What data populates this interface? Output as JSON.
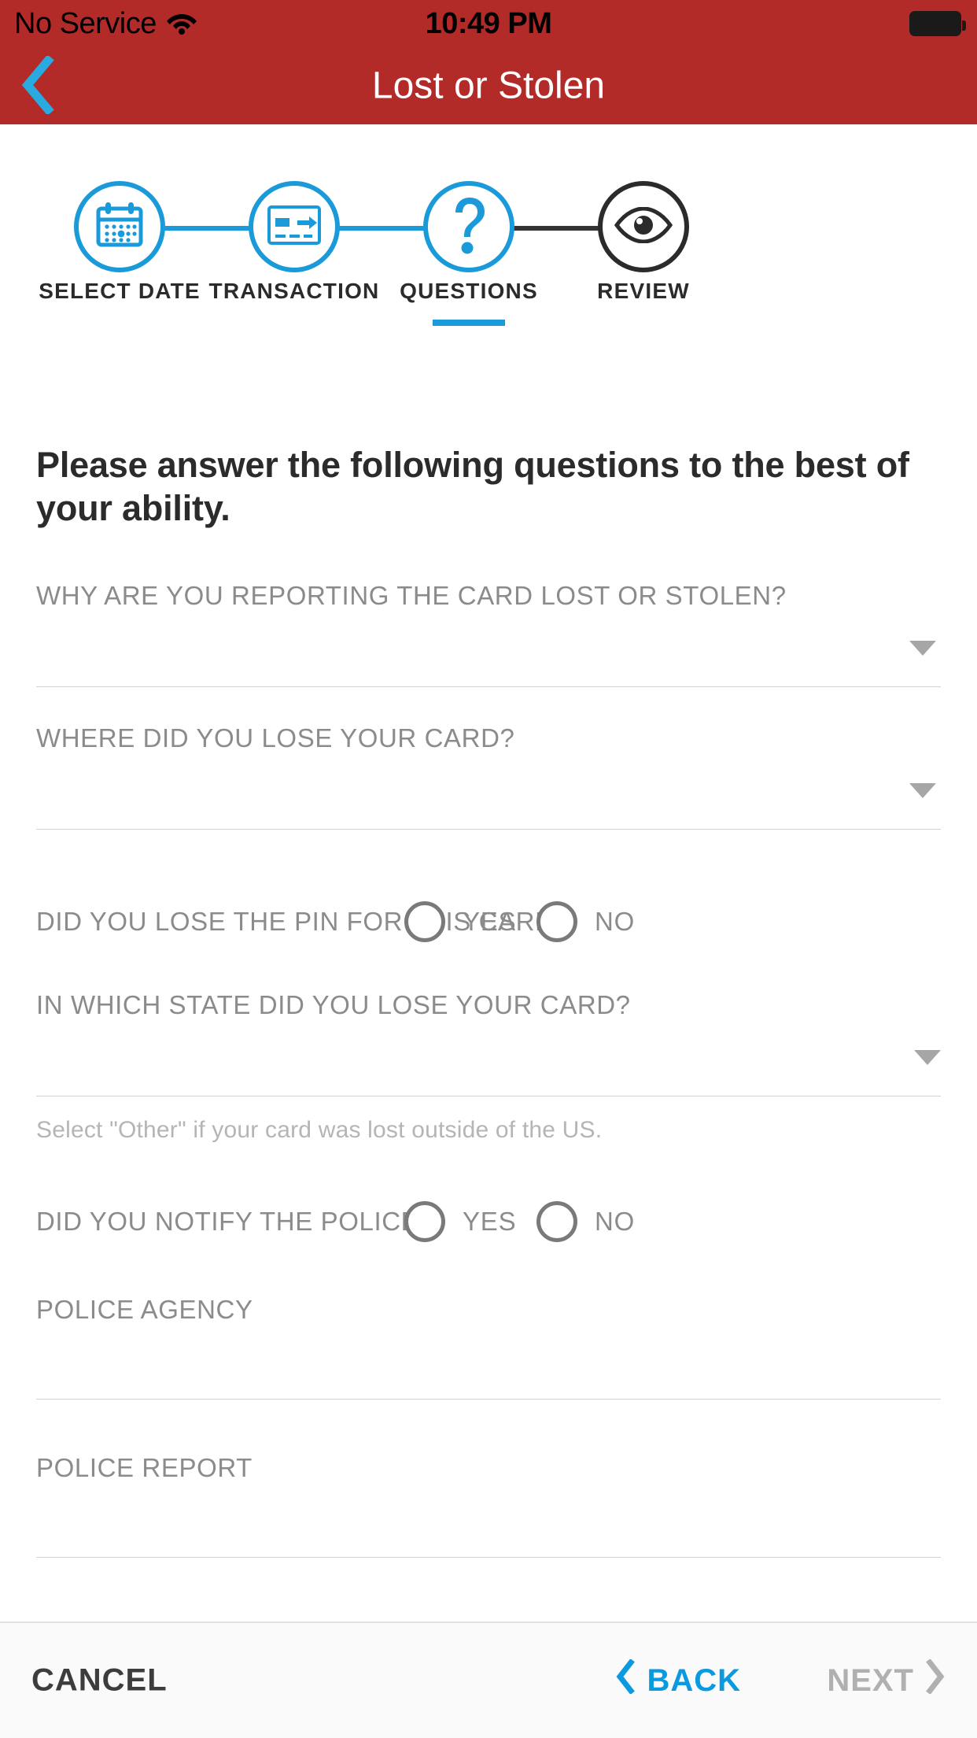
{
  "status_bar": {
    "carrier": "No Service",
    "wifi_icon": "wifi-icon",
    "time": "10:49 PM",
    "battery_icon": "battery-full-icon"
  },
  "nav": {
    "back_icon": "chevron-left-icon",
    "title": "Lost or Stolen",
    "bar_color": "#b32b28",
    "back_color": "#29abe2"
  },
  "stepper": {
    "active_color": "#1a9ad8",
    "inactive_color": "#2b2b2b",
    "steps": [
      {
        "label": "SELECT DATE",
        "icon": "calendar-icon",
        "state": "complete"
      },
      {
        "label": "TRANSACTION",
        "icon": "card-transfer-icon",
        "state": "complete"
      },
      {
        "label": "QUESTIONS",
        "icon": "question-mark-icon",
        "state": "current"
      },
      {
        "label": "REVIEW",
        "icon": "eye-icon",
        "state": "upcoming"
      }
    ]
  },
  "form": {
    "heading": "Please answer the following questions to the best of your ability.",
    "q_reason_label": "WHY ARE YOU REPORTING THE CARD LOST OR STOLEN?",
    "q_reason_value": "",
    "q_where_label": "WHERE DID YOU LOSE YOUR CARD?",
    "q_where_value": "",
    "q_pin_label": "DID YOU LOSE THE PIN FOR THIS CARD?",
    "q_pin_yes": "YES",
    "q_pin_no": "NO",
    "q_state_label": "IN WHICH STATE DID YOU LOSE YOUR CARD?",
    "q_state_value": "",
    "q_state_helper": "Select \"Other\" if your card was lost outside of the US.",
    "q_police_label": "DID YOU NOTIFY THE POLICE?",
    "q_police_yes": "YES",
    "q_police_no": "NO",
    "f_agency_label": "POLICE AGENCY",
    "f_agency_value": "",
    "f_report_label": "POLICE REPORT",
    "f_report_value": ""
  },
  "bottom_bar": {
    "cancel_label": "CANCEL",
    "back_label": "BACK",
    "back_icon": "chevron-left-icon",
    "next_label": "NEXT",
    "next_icon": "chevron-right-icon",
    "back_color": "#0a9ae0",
    "next_color": "#b0b0b0"
  }
}
